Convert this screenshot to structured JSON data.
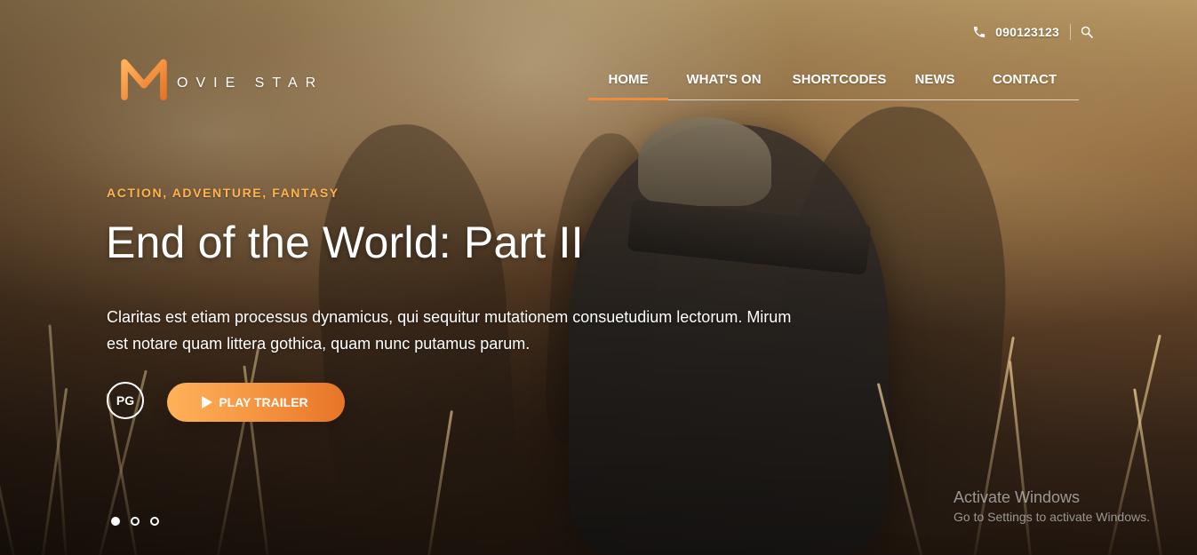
{
  "header": {
    "contact": {
      "phone_icon": "phone-icon",
      "phone_number": "090123123",
      "search_icon": "search-icon"
    },
    "logo": {
      "mark_letter": "M",
      "text": "OVIE STAR",
      "accent_color": "#f08a3e"
    },
    "nav": {
      "items": [
        {
          "label": "HOME",
          "active": true
        },
        {
          "label": "WHAT'S ON",
          "active": false
        },
        {
          "label": "SHORTCODES",
          "active": false
        },
        {
          "label": "NEWS",
          "active": false
        },
        {
          "label": "CONTACT",
          "active": false
        }
      ],
      "active_underline_color": "#f08a3e"
    }
  },
  "hero": {
    "genres": "ACTION, ADVENTURE, FANTASY",
    "title": "End of the World: Part II",
    "description": "Claritas est etiam processus dynamicus, qui sequitur mutationem consuetudium lectorum. Mirum est notare quam littera gothica, quam nunc putamus parum.",
    "rating": "PG",
    "play_trailer_label": "PLAY TRAILER",
    "play_icon": "play-icon",
    "slider": {
      "dots": [
        {
          "active": true
        },
        {
          "active": false
        },
        {
          "active": false
        }
      ]
    }
  },
  "watermark": {
    "title": "Activate Windows",
    "subtitle": "Go to Settings to activate Windows."
  },
  "colors": {
    "accent": "#f08a3e",
    "genre_text": "#ffb34f",
    "text": "#ffffff"
  }
}
